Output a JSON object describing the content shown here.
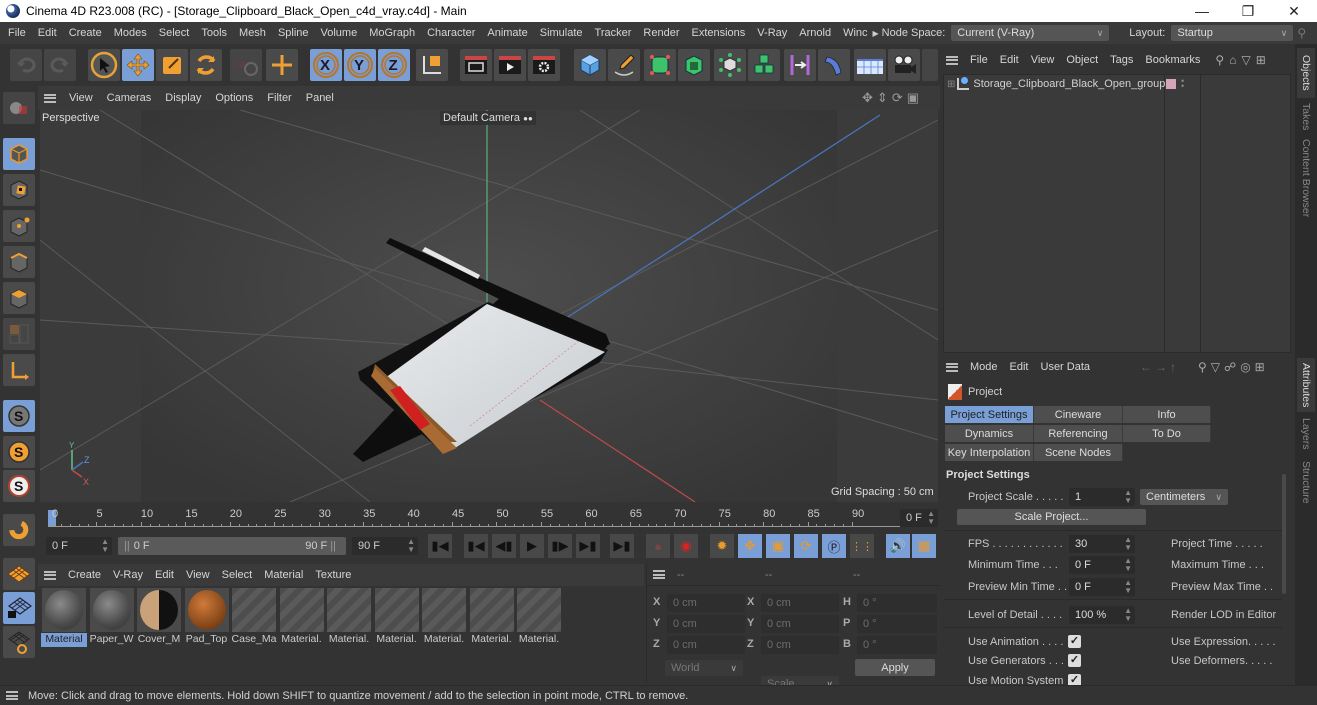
{
  "window": {
    "title": "Cinema 4D R23.008 (RC) - [Storage_Clipboard_Black_Open_c4d_vray.c4d] - Main",
    "controls": [
      "minimize",
      "restore",
      "close"
    ]
  },
  "menubar": {
    "items": [
      "File",
      "Edit",
      "Create",
      "Modes",
      "Select",
      "Tools",
      "Mesh",
      "Spline",
      "Volume",
      "MoGraph",
      "Character",
      "Animate",
      "Simulate",
      "Tracker",
      "Render",
      "Extensions",
      "V-Ray",
      "Arnold",
      "Winc"
    ],
    "node_space_label": "Node Space:",
    "node_space_value": "Current (V-Ray)",
    "layout_label": "Layout:",
    "layout_value": "Startup"
  },
  "main_toolbar": {
    "icons": [
      "undo-icon",
      "redo-icon",
      "select-live-icon",
      "move-icon",
      "scale-icon",
      "rotate-icon",
      "recent-tools-icon",
      "add-icon",
      "x-axis-icon",
      "y-axis-icon",
      "z-axis-icon",
      "coordinate-system-icon",
      "render-view-icon",
      "render-picture-viewer-icon",
      "render-settings-icon",
      "cube-icon",
      "pen-icon",
      "subdivision-icon",
      "extrude-icon",
      "cloner-icon",
      "array-icon",
      "symmetry-icon",
      "bend-icon",
      "floor-icon",
      "camera-icon"
    ]
  },
  "left_toolbar": {
    "icons": [
      "make-editable-icon",
      "model-mode-icon",
      "texture-mode-icon",
      "points-mode-icon",
      "edges-mode-icon",
      "polygons-mode-icon",
      "uvw-mode-icon",
      "axis-mode-icon",
      "solo-off-icon",
      "solo-single-icon",
      "solo-hierarchy-icon",
      "snap-icon",
      "workplane-icon",
      "locked-workplane-icon",
      "planar-workplane-icon"
    ]
  },
  "viewport": {
    "menu": [
      "View",
      "Cameras",
      "Display",
      "Options",
      "Filter",
      "Panel"
    ],
    "view_name": "Perspective",
    "camera_name": "Default Camera",
    "grid_spacing": "Grid Spacing : 50 cm",
    "axis_labels": {
      "x": "X",
      "y": "Y",
      "z": "Z"
    }
  },
  "timeline": {
    "ticks": [
      "0",
      "5",
      "10",
      "15",
      "20",
      "25",
      "30",
      "35",
      "40",
      "45",
      "50",
      "55",
      "60",
      "65",
      "70",
      "75",
      "80",
      "85",
      "90"
    ],
    "current_frame": "0 F",
    "start_field": "0 F",
    "range_start": "0 F",
    "range_end": "90 F",
    "end_field": "90 F",
    "current_field": "0 F"
  },
  "materials": {
    "menu": [
      "Create",
      "V-Ray",
      "Edit",
      "View",
      "Select",
      "Material",
      "Texture"
    ],
    "items": [
      {
        "label": "Material",
        "type": "grey",
        "selected": true
      },
      {
        "label": "Paper_W",
        "type": "grey",
        "selected": false
      },
      {
        "label": "Cover_M",
        "type": "half",
        "selected": false
      },
      {
        "label": "Pad_Top",
        "type": "cork",
        "selected": false
      },
      {
        "label": "Case_Ma",
        "type": "empty",
        "selected": false
      },
      {
        "label": "Material.",
        "type": "empty",
        "selected": false
      },
      {
        "label": "Material.",
        "type": "empty",
        "selected": false
      },
      {
        "label": "Material.",
        "type": "empty",
        "selected": false
      },
      {
        "label": "Material.",
        "type": "empty",
        "selected": false
      },
      {
        "label": "Material.",
        "type": "empty",
        "selected": false
      },
      {
        "label": "Material.",
        "type": "empty",
        "selected": false
      }
    ]
  },
  "coordinates": {
    "headers": [
      "--",
      "--",
      "--"
    ],
    "rows": [
      {
        "l1": "X",
        "v1": "0 cm",
        "l2": "X",
        "v2": "0 cm",
        "l3": "H",
        "v3": "0 °"
      },
      {
        "l1": "Y",
        "v1": "0 cm",
        "l2": "Y",
        "v2": "0 cm",
        "l3": "P",
        "v3": "0 °"
      },
      {
        "l1": "Z",
        "v1": "0 cm",
        "l2": "Z",
        "v2": "0 cm",
        "l3": "B",
        "v3": "0 °"
      }
    ],
    "space": "World",
    "mode": "Scale",
    "apply": "Apply"
  },
  "objects": {
    "menu": [
      "File",
      "Edit",
      "View",
      "Object",
      "Tags",
      "Bookmarks"
    ],
    "tree": [
      {
        "name": "Storage_Clipboard_Black_Open_group",
        "layer_color": "#d4a5b8"
      }
    ]
  },
  "attributes": {
    "menu": [
      "Mode",
      "Edit",
      "User Data"
    ],
    "object": "Project",
    "tabs": [
      {
        "label": "Project Settings",
        "selected": true
      },
      {
        "label": "Cineware",
        "selected": false
      },
      {
        "label": "Info",
        "selected": false
      },
      {
        "label": "Dynamics",
        "selected": false
      },
      {
        "label": "Referencing",
        "selected": false
      },
      {
        "label": "To Do",
        "selected": false
      },
      {
        "label": "Key Interpolation",
        "selected": false
      },
      {
        "label": "Scene Nodes",
        "selected": false
      }
    ],
    "section": "Project Settings",
    "project_scale_label": "Project Scale . . . . .",
    "project_scale_value": "1",
    "project_scale_unit": "Centimeters",
    "scale_project_button": "Scale Project...",
    "fps_label": "FPS . . . . . . . . . . . .",
    "fps_value": "30",
    "project_time_label": "Project Time . . . . .",
    "min_time_label": "Minimum Time . . .",
    "min_time_value": "0 F",
    "max_time_label": "Maximum Time . . .",
    "prev_min_label": "Preview Min Time . .",
    "prev_min_value": "0 F",
    "prev_max_label": "Preview Max Time . .",
    "lod_label": "Level of Detail . . . .",
    "lod_value": "100 %",
    "render_lod_label": "Render LOD in Editor",
    "use_animation": {
      "label": "Use Animation . . . .",
      "checked": true
    },
    "use_generators": {
      "label": "Use Generators . . . .",
      "checked": true
    },
    "use_motion": {
      "label": "Use Motion System",
      "checked": true
    },
    "use_expression": {
      "label": "Use Expression. . . . ."
    },
    "use_deformers": {
      "label": "Use Deformers. . . . ."
    }
  },
  "side_tabs": {
    "top": [
      "Objects",
      "Takes",
      "Content Browser"
    ],
    "bottom": [
      "Attributes",
      "Layers",
      "Structure"
    ]
  },
  "status": "Move: Click and drag to move elements. Hold down SHIFT to quantize movement / add to the selection in point mode, CTRL to remove."
}
